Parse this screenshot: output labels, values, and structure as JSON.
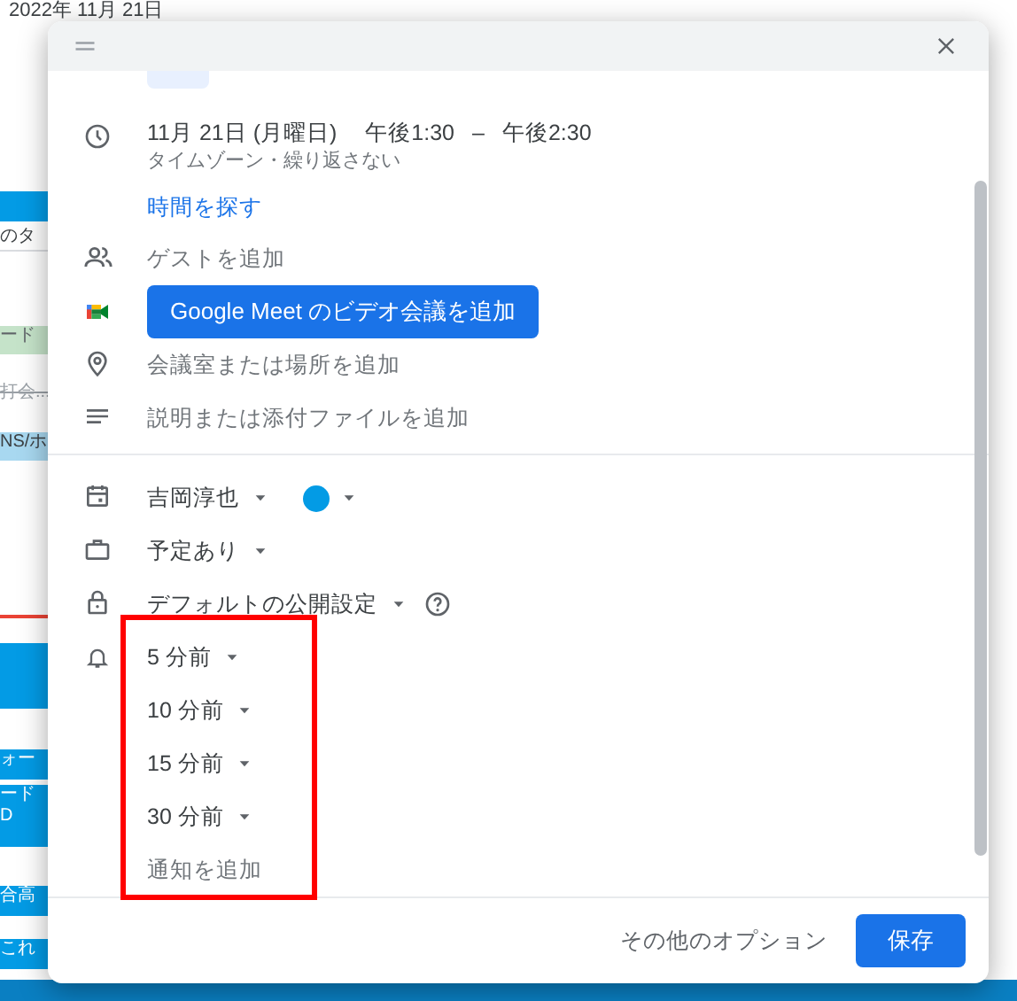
{
  "background": {
    "date_heading": "2022年 11月 21日",
    "fragments": [
      {
        "kind": "event"
      },
      {
        "kind": "label",
        "text": "のタ"
      },
      {
        "kind": "green",
        "text": "ード"
      },
      {
        "kind": "struck",
        "text": "打会..."
      },
      {
        "kind": "light",
        "text": "NS/ホ"
      },
      {
        "kind": "now"
      },
      {
        "kind": "event"
      },
      {
        "kind": "event",
        "text": "ォー"
      },
      {
        "kind": "event",
        "text": "ード\nD"
      },
      {
        "kind": "event",
        "text": "合高"
      },
      {
        "kind": "event",
        "text": "これ"
      }
    ]
  },
  "dialog": {
    "when": {
      "date": "11月 21日 (月曜日)",
      "start": "午後1:30",
      "separator": "–",
      "end": "午後2:30",
      "details": "タイムゾーン・繰り返さない"
    },
    "find_time": "時間を探す",
    "guests": "ゲストを追加",
    "meet_button": "Google Meet のビデオ会議を追加",
    "location": "会議室または場所を追加",
    "description": "説明または添付ファイルを追加",
    "calendar": {
      "owner": "吉岡淳也",
      "color": "#039be5"
    },
    "availability": "予定あり",
    "visibility": "デフォルトの公開設定",
    "notifications": {
      "highlighted": true,
      "items": [
        {
          "text": "5 分前"
        },
        {
          "text": "10 分前"
        },
        {
          "text": "15 分前"
        },
        {
          "text": "30 分前"
        }
      ],
      "add": "通知を追加"
    },
    "more_options": "その他のオプション",
    "save": "保存"
  }
}
